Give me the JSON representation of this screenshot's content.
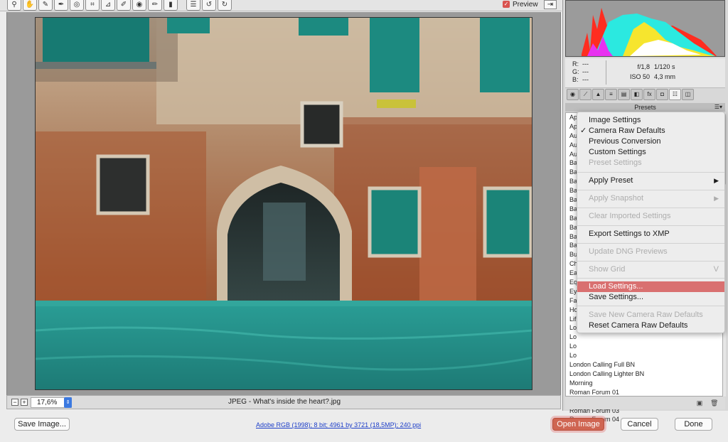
{
  "toolbar": {
    "tools": [
      {
        "icon": "zoom-icon",
        "glyph": "⚲"
      },
      {
        "icon": "hand-icon",
        "glyph": "✋"
      },
      {
        "icon": "white-balance-icon",
        "glyph": "✎"
      },
      {
        "icon": "color-sampler-icon",
        "glyph": "✒"
      },
      {
        "icon": "target-adjust-icon",
        "glyph": "◎"
      },
      {
        "icon": "crop-icon",
        "glyph": "⌗"
      },
      {
        "icon": "straighten-icon",
        "glyph": "⊿"
      },
      {
        "icon": "spot-removal-icon",
        "glyph": "✐"
      },
      {
        "icon": "red-eye-icon",
        "glyph": "◉"
      },
      {
        "icon": "adjustment-brush-icon",
        "glyph": "✏"
      },
      {
        "icon": "graduated-filter-icon",
        "glyph": "▮"
      },
      {
        "icon": "preferences-icon",
        "glyph": "☰"
      },
      {
        "icon": "rotate-left-icon",
        "glyph": "↺"
      },
      {
        "icon": "rotate-right-icon",
        "glyph": "↻"
      }
    ],
    "preview_label": "Preview",
    "preview_checked": true,
    "fullscreen_icon": "fullscreen-icon"
  },
  "image": {
    "zoom": "17,6%",
    "file_label": "JPEG  -  What's inside the heart?.jpg"
  },
  "readout": {
    "r_label": "R:",
    "r_value": "---",
    "g_label": "G:",
    "g_value": "---",
    "b_label": "B:",
    "b_value": "---",
    "aperture": "f/1,8",
    "shutter": "1/120 s",
    "iso": "ISO 50",
    "focal": "4,3 mm"
  },
  "panel": {
    "title": "Presets",
    "tabs": [
      "basic-icon",
      "tone-curve-icon",
      "detail-icon",
      "hsl-icon",
      "split-toning-icon",
      "lens-icon",
      "fx-icon",
      "camera-calibration-icon",
      "presets-icon",
      "snapshots-icon"
    ],
    "presets_visible_prefixes": [
      "Ap",
      "Ap",
      "Au",
      "Au",
      "Au",
      "Ba",
      "Ba",
      "Ba",
      "Ba",
      "Ba",
      "Ba",
      "Ba",
      "Ba",
      "Ba",
      "Ba",
      "Bu",
      "Ch",
      "Ea",
      "Eq",
      "Ey",
      "Fa",
      "Ho",
      "Lif",
      "Lo",
      "Lo",
      "Lo",
      "Lo"
    ],
    "presets_full": [
      "London Calling Full BN",
      "London Calling Lighter BN",
      "Morning",
      "Roman Forum 01",
      "Roman Forum 02",
      "Roman Forum 03",
      "Roman Forum 04"
    ]
  },
  "menu": {
    "items": [
      {
        "label": "Image Settings",
        "disabled": false
      },
      {
        "label": "Camera Raw Defaults",
        "disabled": false,
        "checked": true
      },
      {
        "label": "Previous Conversion",
        "disabled": false
      },
      {
        "label": "Custom Settings",
        "disabled": false
      },
      {
        "label": "Preset Settings",
        "disabled": true
      },
      {
        "label": "Apply Preset",
        "disabled": false,
        "submenu": true
      },
      {
        "label": "Apply Snapshot",
        "disabled": true,
        "submenu": true
      },
      {
        "label": "Clear Imported Settings",
        "disabled": true
      },
      {
        "label": "Export Settings to XMP",
        "disabled": false
      },
      {
        "label": "Update DNG Previews",
        "disabled": true
      },
      {
        "label": "Show Grid",
        "disabled": true,
        "shortcut": "V"
      },
      {
        "label": "Load Settings...",
        "disabled": false,
        "highlighted": true
      },
      {
        "label": "Save Settings...",
        "disabled": false
      },
      {
        "label": "Save New Camera Raw Defaults",
        "disabled": true
      },
      {
        "label": "Reset Camera Raw Defaults",
        "disabled": false
      }
    ]
  },
  "footer": {
    "save_image": "Save Image...",
    "info": "Adobe RGB (1998); 8 bit; 4961 by 3721 (18,5MP); 240 ppi",
    "open_image": "Open Image",
    "cancel": "Cancel",
    "done": "Done"
  },
  "colors": {
    "accent_red": "#cf6552",
    "menu_highlight": "#d97070",
    "link_blue": "#1d3ec8"
  }
}
